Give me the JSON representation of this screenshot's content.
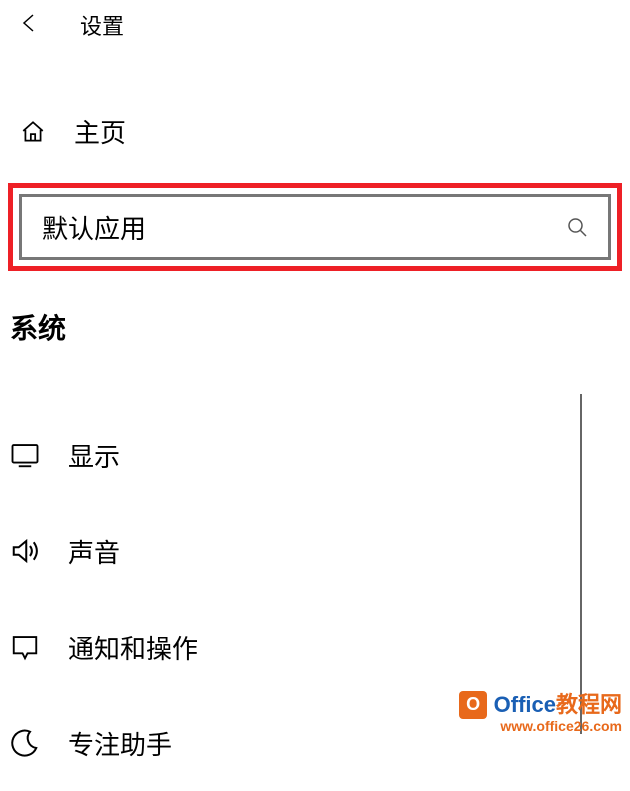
{
  "header": {
    "title": "设置"
  },
  "home": {
    "label": "主页"
  },
  "search": {
    "value": "默认应用"
  },
  "section": {
    "title": "系统"
  },
  "menu": {
    "items": [
      {
        "label": "显示"
      },
      {
        "label": "声音"
      },
      {
        "label": "通知和操作"
      },
      {
        "label": "专注助手"
      }
    ]
  },
  "watermark": {
    "brand1": "Office",
    "brand2": "教程网",
    "url": "www.office26.com"
  }
}
